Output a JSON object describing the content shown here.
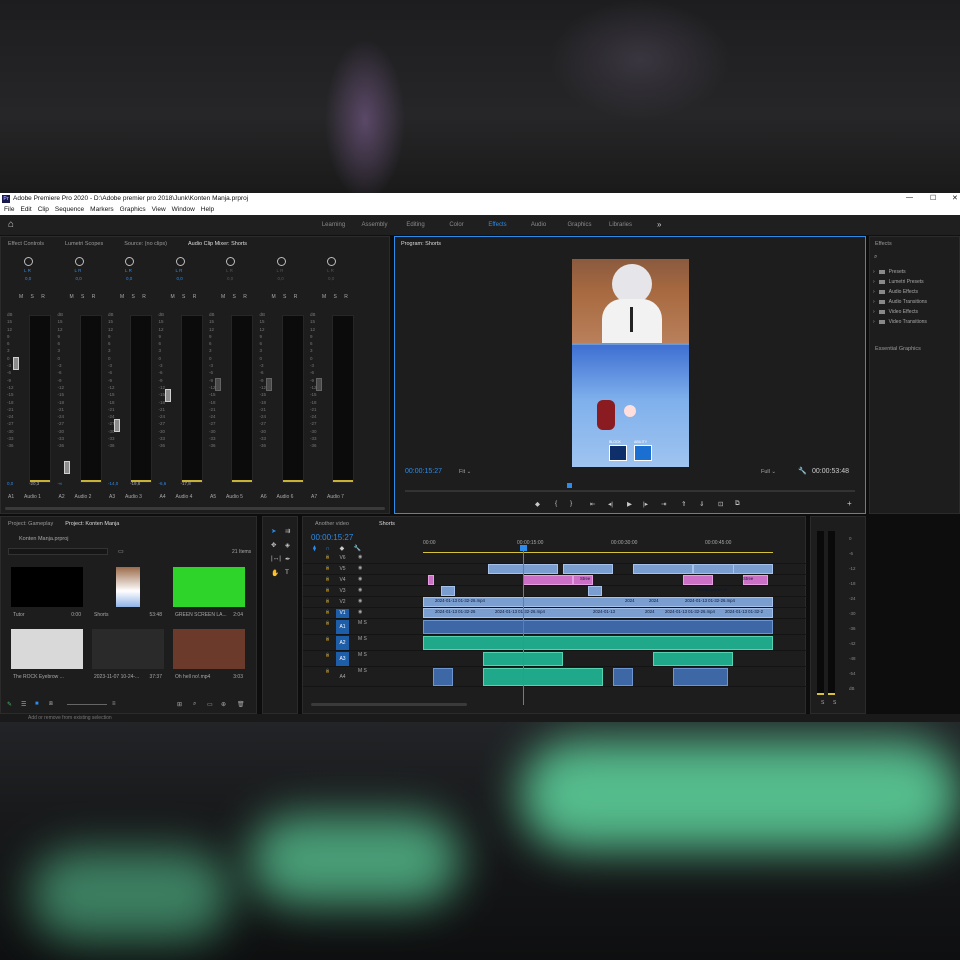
{
  "window": {
    "title": "Adobe Premiere Pro 2020 - D:\\Adobe premier pro 2018\\Junk\\Konten Manja.prproj",
    "controls": [
      "—",
      "☐",
      "✕"
    ]
  },
  "menu": [
    "File",
    "Edit",
    "Clip",
    "Sequence",
    "Markers",
    "Graphics",
    "View",
    "Window",
    "Help"
  ],
  "workspaces": [
    "Learning",
    "Assembly",
    "Editing",
    "Color",
    "Effects",
    "Audio",
    "Graphics",
    "Libraries"
  ],
  "active_workspace": "Effects",
  "source_tabs": [
    "Effect Controls",
    "Lumetri Scopes",
    "Source: (no clips)",
    "Audio Clip Mixer: Shorts"
  ],
  "mixer": {
    "channels": [
      {
        "id": "A1",
        "name": "Audio 1",
        "lr": "L  R",
        "val": "0,0",
        "bottom_left": "0,0",
        "bottom_right": "-20,3",
        "level": 0.86
      },
      {
        "id": "A2",
        "name": "Audio 2",
        "lr": "L  R",
        "val": "0,0",
        "bottom_left": "-∞",
        "bottom_right": "",
        "level": 0.17
      },
      {
        "id": "A3",
        "name": "Audio 3",
        "lr": "L  R",
        "val": "0,0",
        "bottom_left": "-14,0",
        "bottom_right": "-19,8",
        "level": 0.45
      },
      {
        "id": "A4",
        "name": "Audio 4",
        "lr": "L  R",
        "val": "0,0",
        "bottom_left": "-6,6",
        "bottom_right": "-17,8",
        "level": 0.65
      },
      {
        "id": "A5",
        "name": "Audio 5",
        "lr": "L  R",
        "val": "0,0",
        "bottom_left": "",
        "bottom_right": "",
        "level": 0.72
      },
      {
        "id": "A6",
        "name": "Audio 6",
        "lr": "L  R",
        "val": "0,0",
        "bottom_left": "",
        "bottom_right": "",
        "level": 0.72
      },
      {
        "id": "A7",
        "name": "Audio 7",
        "lr": "L  R",
        "val": "0,0",
        "bottom_left": "",
        "bottom_right": "",
        "level": 0.72
      }
    ],
    "scale": [
      "dB",
      "15",
      "12",
      "9",
      "6",
      "3",
      "0",
      "-3",
      "-6",
      "-9",
      "-12",
      "-15",
      "-18",
      "-21",
      "-24",
      "-27",
      "-30",
      "-33",
      "-36"
    ]
  },
  "program": {
    "title": "Program: Shorts",
    "timecode": "00:00:15:27",
    "fit": "Fit",
    "quality": "Full",
    "duration": "00:00:53:48",
    "hud": [
      "BLOCK",
      "ABILITY"
    ],
    "playhead": 0.36
  },
  "effects": {
    "title": "Effects",
    "items": [
      "Presets",
      "Lumetri Presets",
      "Audio Effects",
      "Audio Transitions",
      "Video Effects",
      "Video Transitions"
    ],
    "footer": "Essential Graphics"
  },
  "project": {
    "tabs": [
      "Project: Gameplay",
      "Project: Konten Manja"
    ],
    "file": "Konten Manja.prproj",
    "count": "21 Items",
    "items": [
      {
        "name": "Tutor",
        "dur": "0:00"
      },
      {
        "name": "Shorts",
        "dur": "53:48"
      },
      {
        "name": "GREEN SCREEN LA...",
        "dur": "2:04"
      },
      {
        "name": "The ROCK Eyebrow ...",
        "dur": ""
      },
      {
        "name": "2023-11-07 10-24-...",
        "dur": "37:37"
      },
      {
        "name": "Oh hell no!.mp4",
        "dur": "3:03"
      }
    ]
  },
  "timeline": {
    "tabs": [
      "Another video",
      "Shorts"
    ],
    "timecode": "00:00:15:27",
    "ruler": [
      "00:00",
      "00:00:15:00",
      "00:00:30:00",
      "00:00:45:00"
    ],
    "video_tracks": [
      "V6",
      "V5",
      "V4",
      "V3",
      "V2",
      "V1"
    ],
    "audio_tracks": [
      "A1",
      "A2",
      "A3",
      "A4"
    ],
    "clips": {
      "v2": [
        "2024-01-13 01-32-26.mp4",
        "2024",
        "2024",
        "2024-01-13 01-32-26.mp4"
      ],
      "v1": [
        "2024-01-13 01-32-26",
        "2024-01-13 01-32-26.mp4",
        "2024-01-13",
        "2024",
        "2024-01-13 01-32-26.mp4",
        "2024-01-13 01-32-2"
      ],
      "v4": [
        "Stree",
        "Stree"
      ],
      "v3": [
        "Sweaty gamer m"
      ]
    }
  },
  "meter_scale": [
    "0",
    "-6",
    "-12",
    "-18",
    "-24",
    "-30",
    "-36",
    "-42",
    "-48",
    "-54",
    "dB"
  ],
  "meter_sr": [
    "S",
    "S"
  ],
  "status": "Add or remove from existing selection",
  "colors": {
    "accent": "#2d8ceb",
    "video_clip": "#7b9ed0",
    "audio_clip": "#1fa98a",
    "pink_clip": "#cc6fc7",
    "bg": "#1d1d1d"
  }
}
